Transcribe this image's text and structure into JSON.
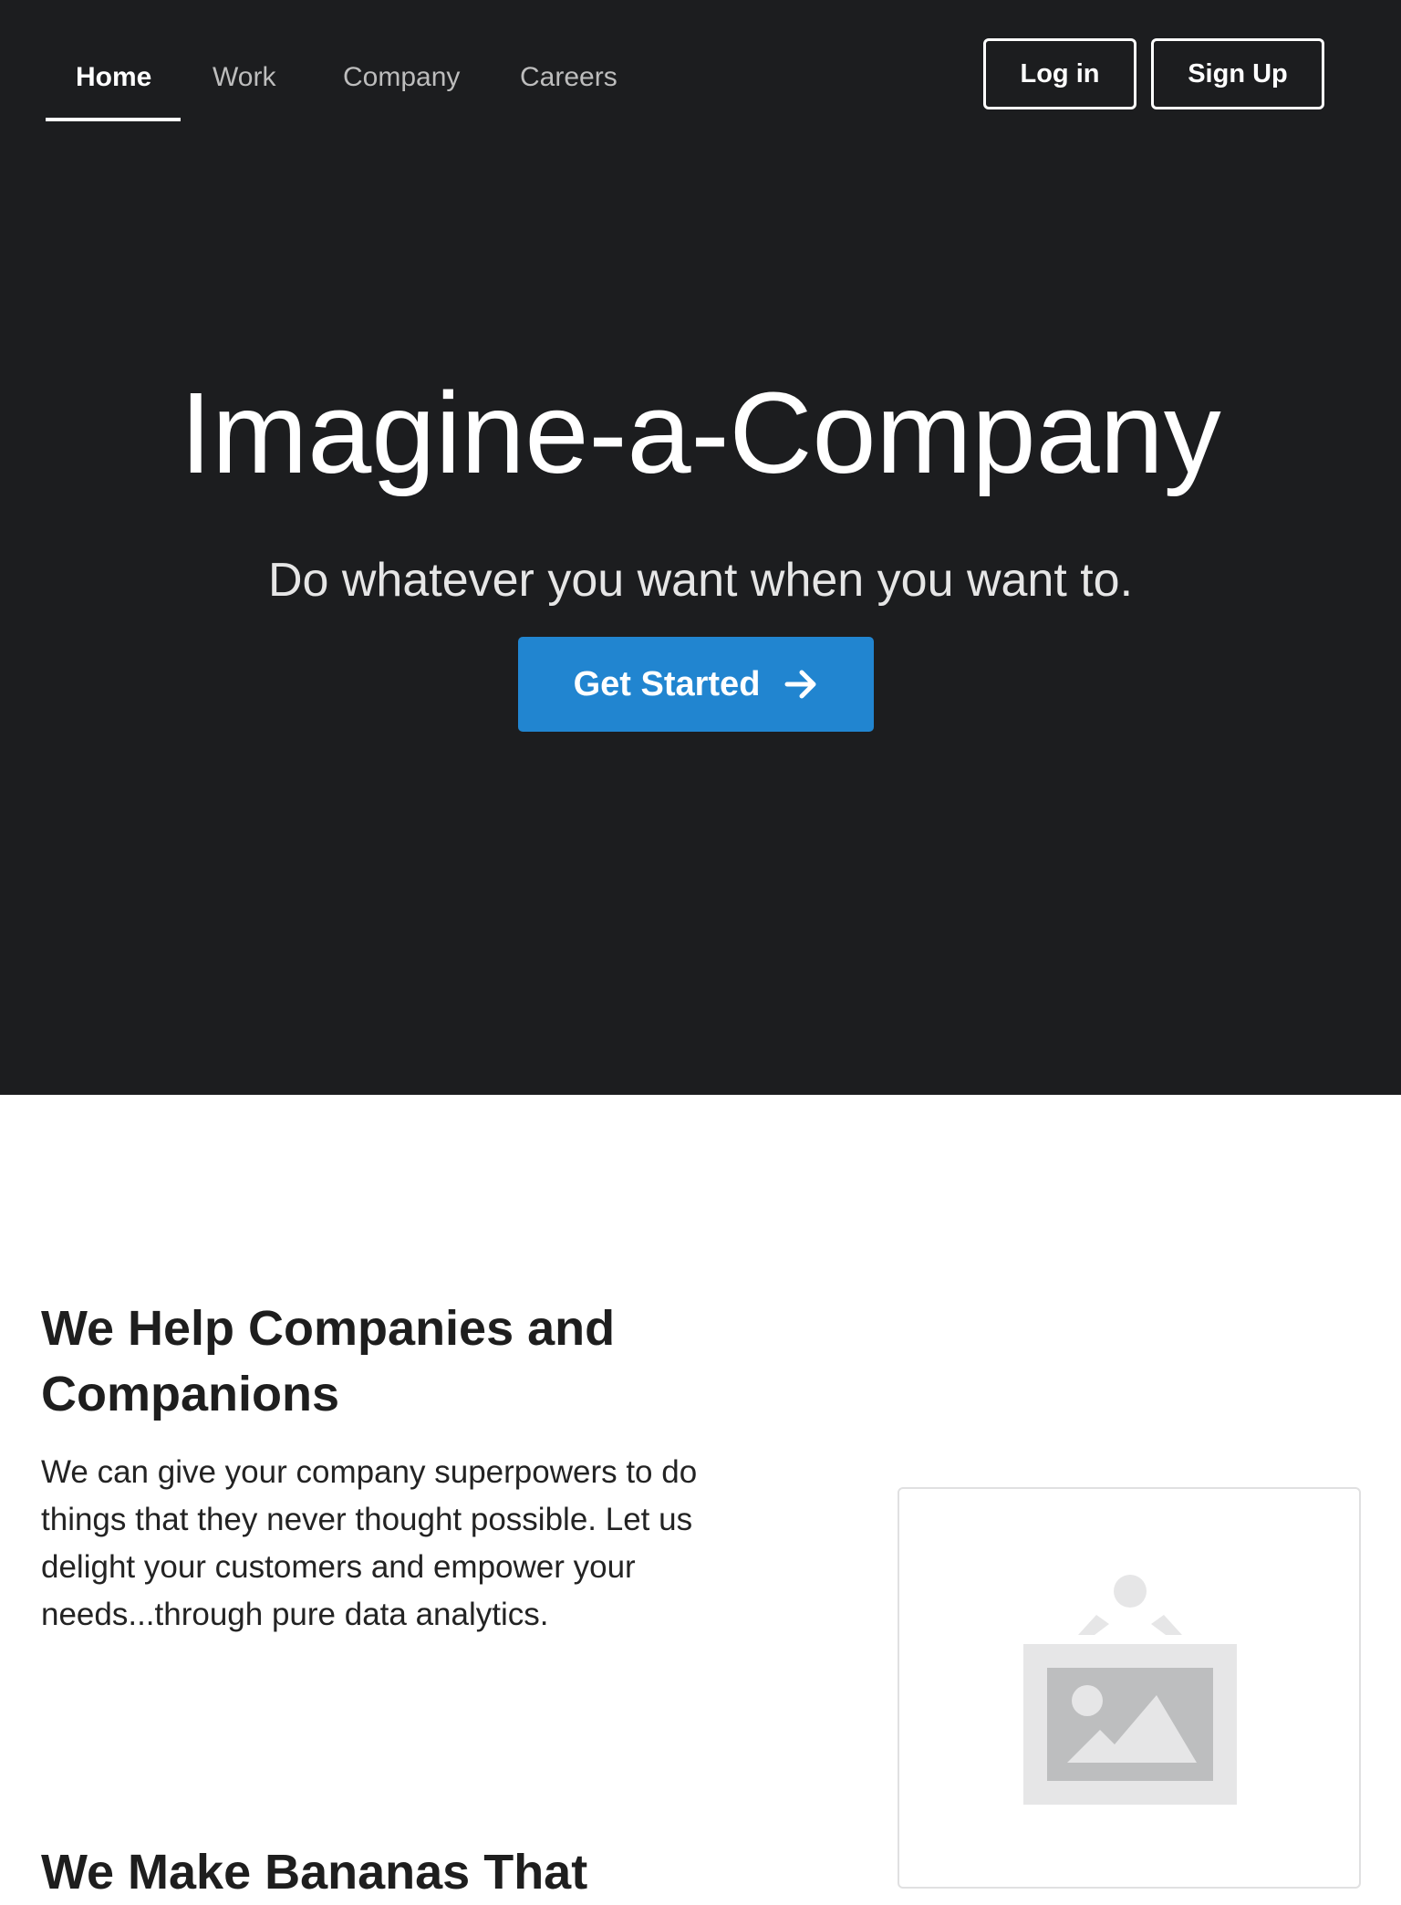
{
  "nav": {
    "items": [
      {
        "label": "Home",
        "active": true
      },
      {
        "label": "Work",
        "active": false
      },
      {
        "label": "Company",
        "active": false
      },
      {
        "label": "Careers",
        "active": false
      }
    ],
    "login_label": "Log in",
    "signup_label": "Sign Up"
  },
  "hero": {
    "title": "Imagine-a-Company",
    "subtitle": "Do whatever you want when you want to.",
    "cta_label": "Get Started",
    "cta_icon": "arrow-right-icon"
  },
  "sections": [
    {
      "title": "We Help Companies and Companions",
      "body": "We can give your company superpowers to do things that they never thought possible. Let us delight your customers and empower your needs...through pure data analytics."
    },
    {
      "title": "We Make Bananas That"
    }
  ],
  "image_card": {
    "icon": "image-placeholder-icon"
  },
  "colors": {
    "hero_background": "#1c1d1f",
    "primary_button": "#2185d0",
    "text_dark": "#1e1e1e",
    "nav_inactive": "#bdbdbd"
  }
}
